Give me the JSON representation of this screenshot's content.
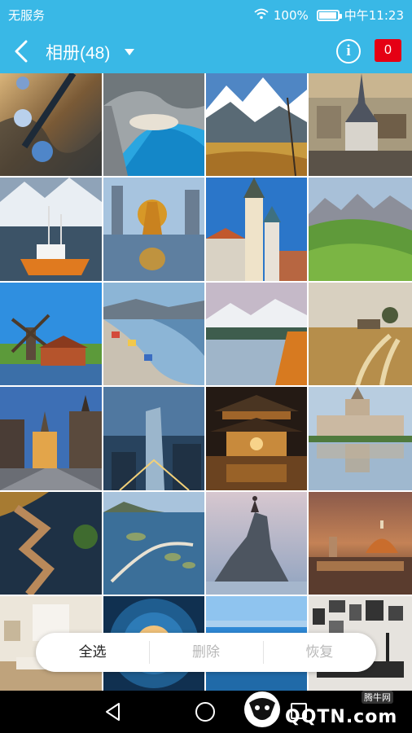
{
  "status_bar": {
    "carrier": "无服务",
    "battery": "100%",
    "time": "中午11:23"
  },
  "header": {
    "title": "相册(48)",
    "info_label": "i",
    "badge_count": "0"
  },
  "photos": [
    {
      "label": "hot-air-balloons"
    },
    {
      "label": "sea-cliff-beach"
    },
    {
      "label": "snowy-mountain-valley"
    },
    {
      "label": "old-town-church"
    },
    {
      "label": "fishing-boat-harbor"
    },
    {
      "label": "golden-sculpture-city"
    },
    {
      "label": "church-tower-village"
    },
    {
      "label": "alpine-meadow"
    },
    {
      "label": "windmill"
    },
    {
      "label": "coastal-town"
    },
    {
      "label": "mountain-lake"
    },
    {
      "label": "wheat-field-path"
    },
    {
      "label": "gothic-square"
    },
    {
      "label": "skyscraper-night"
    },
    {
      "label": "chinese-temple-night"
    },
    {
      "label": "palace-reflection"
    },
    {
      "label": "zigzag-boardwalk"
    },
    {
      "label": "ocean-road-bridge"
    },
    {
      "label": "rock-summit-hiker"
    },
    {
      "label": "florence-cathedral"
    },
    {
      "label": "living-room"
    },
    {
      "label": "spiral-ceiling"
    },
    {
      "label": "ocean-horizon"
    },
    {
      "label": "gallery-wall-room"
    }
  ],
  "actions": {
    "select_all": "全选",
    "delete": "删除",
    "restore": "恢复"
  },
  "watermark": {
    "brand": "QQTN.com",
    "sub": "腾牛网"
  }
}
